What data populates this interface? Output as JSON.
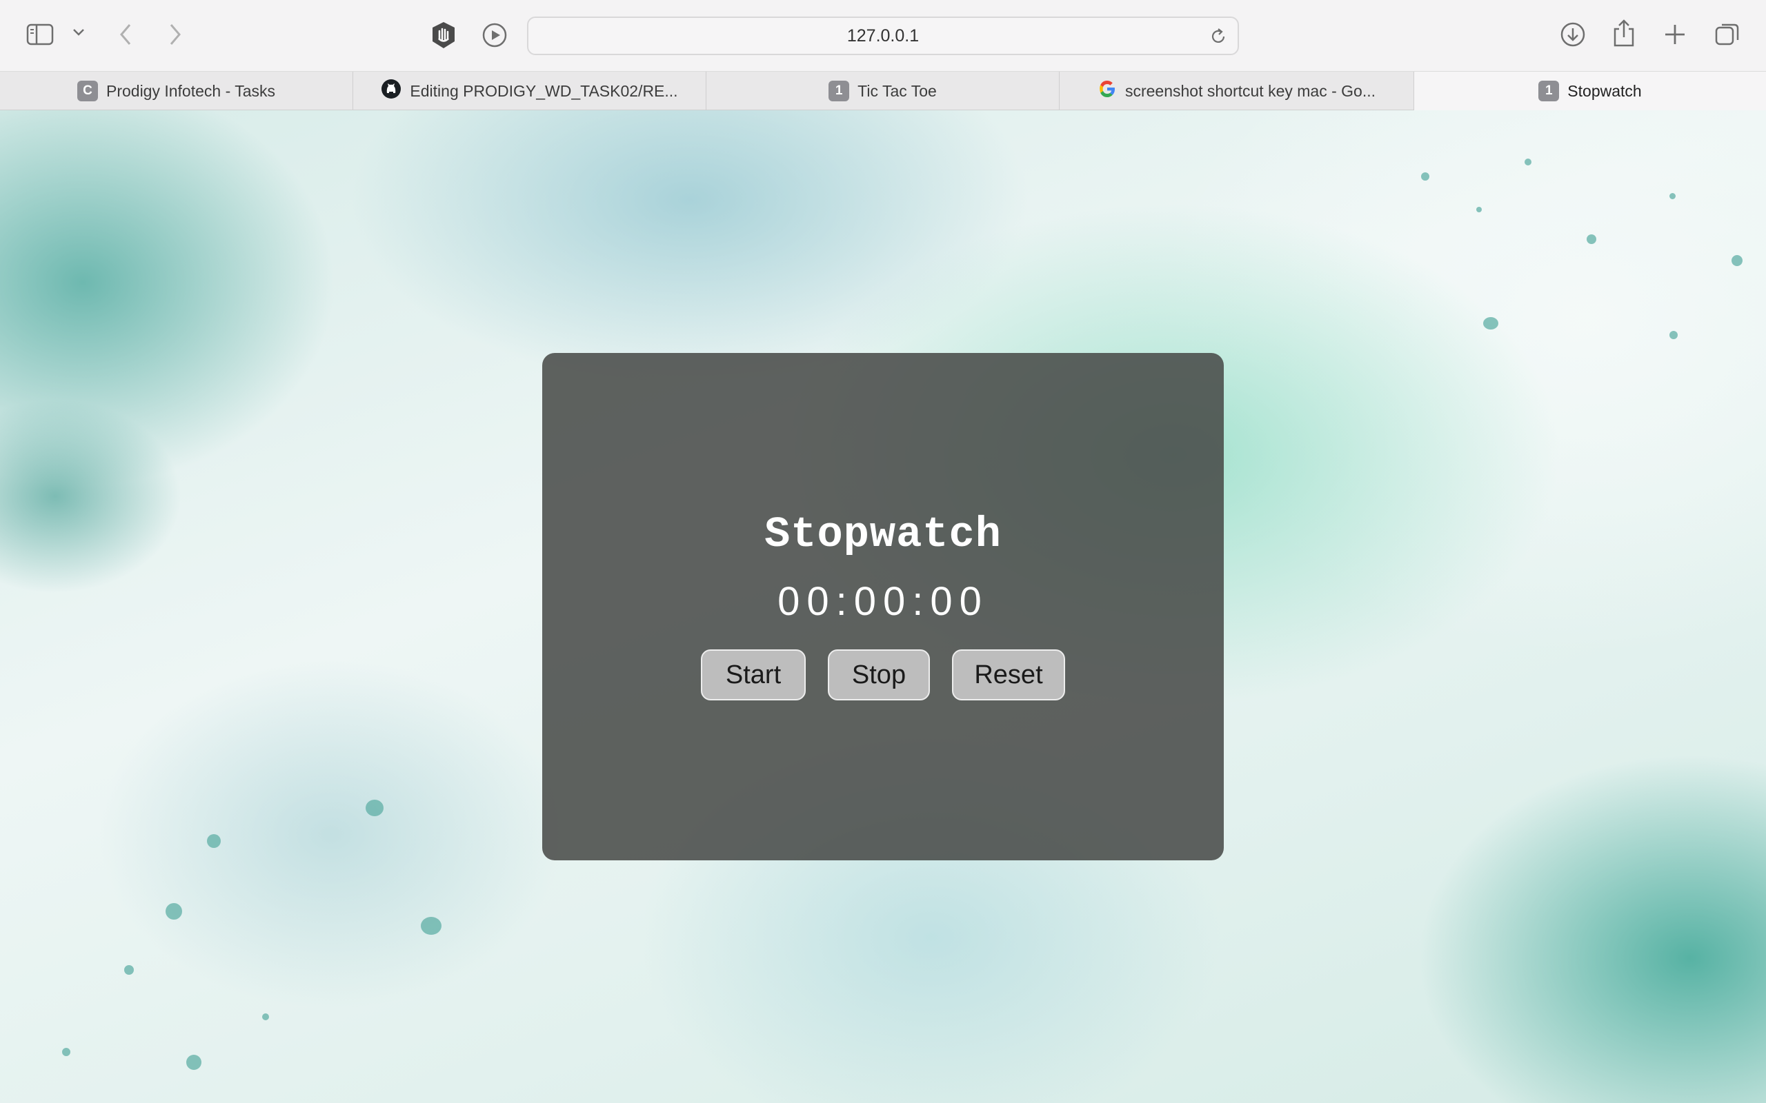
{
  "browser": {
    "url": "127.0.0.1",
    "tabs": [
      {
        "label": "Prodigy Infotech - Tasks",
        "favicon": "C",
        "icon": "letter-c-icon",
        "active": false
      },
      {
        "label": "Editing PRODIGY_WD_TASK02/RE...",
        "favicon": "",
        "icon": "github-icon",
        "active": false
      },
      {
        "label": "Tic Tac Toe",
        "favicon": "1",
        "icon": "number-one-icon",
        "active": false
      },
      {
        "label": "screenshot shortcut key mac - Go...",
        "favicon": "",
        "icon": "google-icon",
        "active": false
      },
      {
        "label": "Stopwatch",
        "favicon": "1",
        "icon": "number-one-icon",
        "active": true
      }
    ],
    "toolbar_icons": [
      "sidebar-icon",
      "chevron-down-icon",
      "back-icon",
      "forward-icon",
      "hand-block-icon",
      "play-icon",
      "reload-icon",
      "download-icon",
      "share-icon",
      "new-tab-icon",
      "tab-overview-icon"
    ]
  },
  "stopwatch": {
    "title": "Stopwatch",
    "display": "00:00:00",
    "buttons": {
      "start": "Start",
      "stop": "Stop",
      "reset": "Reset"
    }
  },
  "colors": {
    "card_background": "#474948",
    "button_background": "#bdbdbd",
    "text": "#ffffff",
    "page_accent": "#5aafa5"
  }
}
